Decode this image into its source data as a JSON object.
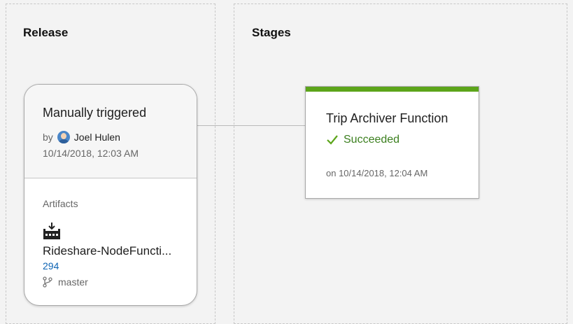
{
  "release": {
    "title": "Release",
    "trigger": "Manually triggered",
    "by_label": "by",
    "user": "Joel Hulen",
    "date": "10/14/2018, 12:03 AM",
    "artifacts_label": "Artifacts",
    "artifact": {
      "name": "Rideshare-NodeFuncti...",
      "build": "294",
      "branch": "master"
    }
  },
  "stages": {
    "title": "Stages",
    "items": [
      {
        "name": "Trip Archiver Function",
        "status": "Succeeded",
        "time": "on 10/14/2018, 12:04 AM",
        "status_color": "#5ca51a"
      }
    ]
  },
  "icons": {
    "avatar": "user-avatar-icon",
    "artifact": "build-artifact-icon",
    "branch": "git-branch-icon",
    "status": "checkmark-icon"
  }
}
